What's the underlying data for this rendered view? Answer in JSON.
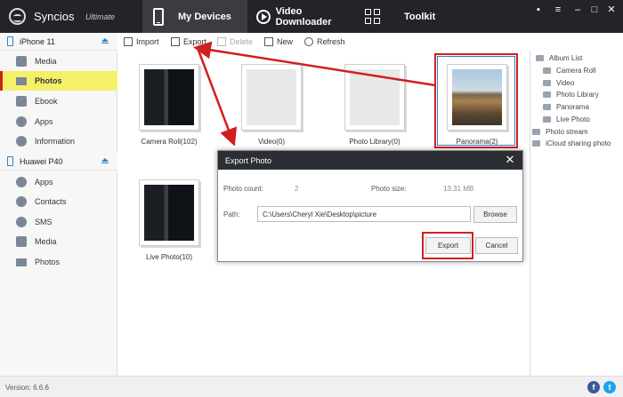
{
  "app": {
    "title": "Syncios",
    "edition": "Ultimate",
    "version_text": "Version: 6.6.6"
  },
  "nav_tabs": [
    {
      "label": "My Devices",
      "icon": "phone-icon",
      "active": true
    },
    {
      "label": "Video Downloader",
      "icon": "play-icon",
      "active": false
    },
    {
      "label": "Toolkit",
      "icon": "grid-icon",
      "active": false
    }
  ],
  "window_controls": [
    {
      "glyph": "▪",
      "name": "feedback-icon"
    },
    {
      "glyph": "≡",
      "name": "menu-icon"
    },
    {
      "glyph": "–",
      "name": "minimize-icon"
    },
    {
      "glyph": "□",
      "name": "maximize-icon"
    },
    {
      "glyph": "✕",
      "name": "close-icon"
    }
  ],
  "devices": [
    {
      "name": "iPhone 11",
      "items": [
        {
          "label": "Media",
          "icon": "media-icon",
          "active": false
        },
        {
          "label": "Photos",
          "icon": "photos-icon",
          "active": true
        },
        {
          "label": "Ebook",
          "icon": "ebook-icon",
          "active": false
        },
        {
          "label": "Apps",
          "icon": "apps-icon",
          "active": false
        },
        {
          "label": "Information",
          "icon": "info-icon",
          "active": false
        }
      ]
    },
    {
      "name": "Huawei P40",
      "items": [
        {
          "label": "Apps",
          "icon": "apps-icon",
          "active": false
        },
        {
          "label": "Contacts",
          "icon": "contacts-icon",
          "active": false
        },
        {
          "label": "SMS",
          "icon": "sms-icon",
          "active": false
        },
        {
          "label": "Media",
          "icon": "media-icon",
          "active": false
        },
        {
          "label": "Photos",
          "icon": "photos-icon",
          "active": false
        }
      ]
    }
  ],
  "toolbar": {
    "import_label": "Import",
    "export_label": "Export",
    "delete_label": "Delete",
    "new_label": "New",
    "refresh_label": "Refresh"
  },
  "albums": [
    {
      "label": "Camera Roll(102)",
      "thumb": "dark"
    },
    {
      "label": "Video(0)",
      "thumb": "blank"
    },
    {
      "label": "Photo Library(0)",
      "thumb": "blank"
    },
    {
      "label": "Panorama(2)",
      "thumb": "pano"
    },
    {
      "label": "Live Photo(10)",
      "thumb": "dark"
    }
  ],
  "album_panel": {
    "root": "Album List",
    "children": [
      "Camera Roll",
      "Video",
      "Photo Library",
      "Panorama",
      "Live Photo"
    ],
    "extra": [
      "Photo stream",
      "iCloud sharing photo"
    ]
  },
  "dialog": {
    "title": "Export Photo",
    "photo_count_label": "Photo count:",
    "photo_count_value": "2",
    "photo_size_label": "Photo size:",
    "photo_size_value": "13.31 MB",
    "path_label": "Path:",
    "path_value": "C:\\Users\\Cheryl Xie\\Desktop\\picture",
    "browse_label": "Browse",
    "export_label": "Export",
    "cancel_label": "Cancel"
  },
  "colors": {
    "accent": "#2a80c5",
    "highlight_red": "#d21e1e",
    "active_item": "#f5f06a",
    "titlebar": "#222427"
  },
  "social": [
    {
      "glyph": "f",
      "name": "facebook-icon",
      "color": "#3b5998"
    },
    {
      "glyph": "t",
      "name": "twitter-icon",
      "color": "#1da1f2"
    }
  ]
}
